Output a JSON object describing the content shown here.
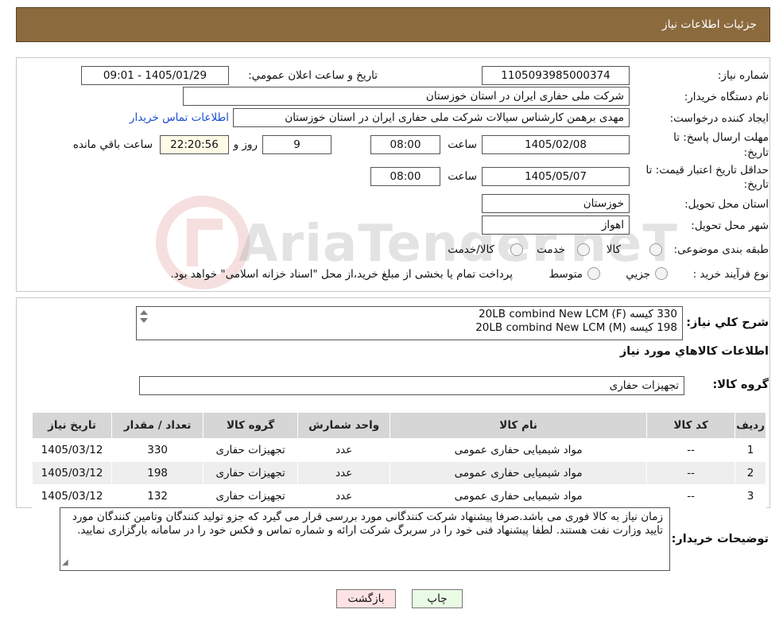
{
  "header": {
    "title": "جزئیات اطلاعات نیاز"
  },
  "info": {
    "need_number_label": "شماره نیاز:",
    "need_number": "1105093985000374",
    "announce_label": "تاریخ و ساعت اعلان عمومي:",
    "announce_value": "1405/01/29 - 09:01",
    "buyer_org_label": "نام دستگاه خريدار:",
    "buyer_org": "شرکت ملی حفاری ایران در استان خوزستان",
    "creator_label": "ایجاد کننده درخواست:",
    "creator": "مهدی برهمن کارشناس سیالات شرکت ملی حفاری ایران در استان خوزستان",
    "contact_link": "اطلاعات تماس خریدار",
    "deadline_label_1": "مهلت ارسال پاسخ: تا",
    "deadline_label_2": "تاریخ:",
    "deadline_date": "1405/02/08",
    "time_label": "ساعت",
    "deadline_time": "08:00",
    "days_value": "9",
    "days_label": "روز و",
    "remaining_time": "22:20:56",
    "remaining_label": "ساعت باقي مانده",
    "validity_label_1": "حداقل تاریخ اعتبار قیمت: تا",
    "validity_label_2": "تاریخ:",
    "validity_date": "1405/05/07",
    "validity_time": "08:00",
    "province_label": "استان محل تحویل:",
    "province": "خوزستان",
    "city_label": "شهر محل تحویل:",
    "city": "اهواز",
    "category_label": "طبقه بندی موضوعی:",
    "category_options": [
      "کالا",
      "خدمت",
      "کالا/خدمت"
    ],
    "process_label": "نوع فرآیند خرید :",
    "process_options": [
      "جزيي",
      "متوسط"
    ],
    "process_note": "پرداخت تمام یا بخشی از مبلغ خرید،از محل \"اسناد خزانه اسلامی\" خواهد بود."
  },
  "description": {
    "label": "شرح كلي نياز:",
    "line1": "330 کیسه 20LB  combind New LCM (F)",
    "line2": "198 کیسه 20LB  combind New LCM (M)"
  },
  "goods": {
    "section_title": "اطلاعات كالاهاي مورد نياز",
    "group_label": "گروه کالا:",
    "group_value": "تجهیزات حفاری",
    "columns": [
      "ردیف",
      "کد کالا",
      "نام کالا",
      "واحد شمارش",
      "گروه کالا",
      "تعداد / مقدار",
      "تاریخ نیاز"
    ],
    "rows": [
      {
        "row": "1",
        "code": "--",
        "name": "مواد شیمیایی حفاری عمومی",
        "unit": "عدد",
        "group": "تجهیزات حفاری",
        "qty": "330",
        "date": "1405/03/12"
      },
      {
        "row": "2",
        "code": "--",
        "name": "مواد شیمیایی حفاری عمومی",
        "unit": "عدد",
        "group": "تجهیزات حفاری",
        "qty": "198",
        "date": "1405/03/12"
      },
      {
        "row": "3",
        "code": "--",
        "name": "مواد شیمیایی حفاری عمومی",
        "unit": "عدد",
        "group": "تجهیزات حفاری",
        "qty": "132",
        "date": "1405/03/12"
      }
    ]
  },
  "buyer_notes": {
    "label": "توضیحات خریدار:",
    "text": "زمان نیاز به کالا فوری می باشد.صرفا پیشنهاد شرکت کنندگانی مورد بررسی قرار می گیرد که جزو تولید کنندگان وتامین کنندگان مورد تایید وزارت نفت هستند. لطفا پیشنهاد فنی خود را در سربرگ شرکت ارائه و شماره تماس و فکس خود را در سامانه بارگزاری نمایید."
  },
  "buttons": {
    "print": "چاپ",
    "back": "بازگشت"
  },
  "watermark": {
    "text": "AriaTender.neT"
  },
  "colors": {
    "header_bg": "#8b6a3e",
    "link": "#1a4fd0",
    "back_bg": "#fde3e3",
    "print_bg": "#eafbe5"
  }
}
